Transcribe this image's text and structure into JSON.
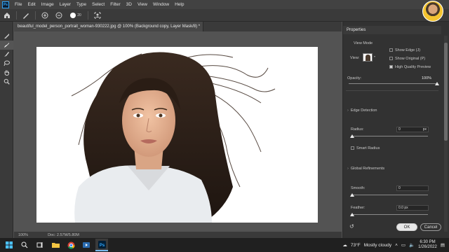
{
  "app": {
    "logo": "Ps"
  },
  "menu": [
    "File",
    "Edit",
    "Image",
    "Layer",
    "Type",
    "Select",
    "Filter",
    "3D",
    "View",
    "Window",
    "Help"
  ],
  "options": {
    "brush_size": "20"
  },
  "document": {
    "tab_title": "beautiful_model_person_portrait_woman-930222.jpg @ 100% (Background copy, Layer Mask/8) *",
    "zoom": "100%",
    "doc_info": "Doc: 2.57M/5.80M"
  },
  "properties": {
    "title": "Properties",
    "view_mode": "View Mode",
    "view_label": "View:",
    "show_edge": "Show Edge (J)",
    "show_original": "Show Original (P)",
    "high_quality_preview": "High Quality Preview",
    "high_quality_checked": true,
    "opacity_label": "Opacity:",
    "opacity_value": "100%",
    "opacity_fraction": 1.0,
    "edge_detection": "Edge Detection",
    "radius_label": "Radius:",
    "radius_value": "0",
    "radius_unit": "px",
    "smart_radius": "Smart Radius",
    "global_refinements": "Global Refinements",
    "smooth_label": "Smooth:",
    "smooth_value": "0",
    "feather_label": "Feather:",
    "feather_value": "0.0 px",
    "ok": "OK",
    "cancel": "Cancel"
  },
  "taskbar": {
    "weather_temp": "73°F",
    "weather_text": "Mostly cloudy",
    "time": "6:30 PM",
    "date": "1/26/2022"
  }
}
